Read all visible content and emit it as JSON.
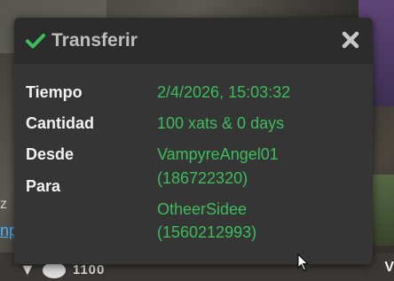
{
  "background": {
    "left_text": "z",
    "left_link": "np",
    "right_text": "V",
    "bottom_code": "1100"
  },
  "dialog": {
    "title": "Transferir",
    "check_icon": "check-icon",
    "close_icon": "close-icon",
    "accent_color": "#3dbd5c",
    "rows": [
      {
        "label": "Tiempo",
        "value": "2/4/2026, 15:03:32"
      },
      {
        "label": "Cantidad",
        "value": "100 xats & 0 days"
      },
      {
        "label": "Desde",
        "value": "VampyreAngel01",
        "value2": "(186722320)"
      },
      {
        "label": "Para",
        "value": "OtheerSidee",
        "value2": "(1560212993)"
      }
    ]
  }
}
